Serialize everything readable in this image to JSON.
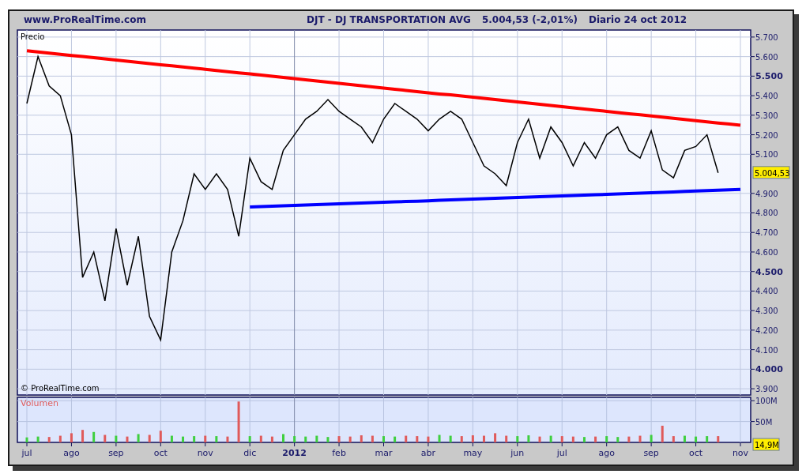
{
  "header": {
    "site": "www.ProRealTime.com",
    "title_parts": [
      "DJT - DJ TRANSPORTATION AVG",
      "5.004,53 (-2,01%)",
      "Diario  24 oct 2012"
    ]
  },
  "price_panel": {
    "label": "Precio",
    "copyright": "© ProRealTime.com",
    "last_price_tag": "5.004,53",
    "chart_data": {
      "type": "line",
      "grid": true,
      "series": [
        {
          "color": "#000000",
          "values": [
            5360,
            5600,
            5450,
            5400,
            5200,
            4470,
            4600,
            4350,
            4720,
            4430,
            4680,
            4270,
            4150,
            4600,
            4760,
            5000,
            4920,
            5000,
            4920,
            4680,
            5080,
            4960,
            4920,
            5120,
            5200,
            5280,
            5320,
            5380,
            5320,
            5280,
            5240,
            5160,
            5280,
            5360,
            5320,
            5280,
            5220,
            5280,
            5320,
            5280,
            5160,
            5040,
            5000,
            4940,
            5160,
            5280,
            5080,
            5240,
            5160,
            5040,
            5160,
            5080,
            5200,
            5240,
            5120,
            5080,
            5220,
            5020,
            4980,
            5120,
            5140,
            5200,
            5005,
            null,
            null
          ]
        },
        {
          "color": "#ff0000",
          "values": [
            5630,
            5624,
            5618,
            5612,
            5606,
            5600,
            5594,
            5588,
            5582,
            5576,
            5570,
            5564,
            5558,
            5553,
            5547,
            5541,
            5535,
            5529,
            5523,
            5517,
            5511,
            5505,
            5499,
            5493,
            5487,
            5481,
            5475,
            5469,
            5463,
            5457,
            5451,
            5445,
            5439,
            5433,
            5427,
            5421,
            5415,
            5409,
            5404,
            5398,
            5392,
            5386,
            5380,
            5374,
            5368,
            5362,
            5356,
            5350,
            5344,
            5338,
            5332,
            5326,
            5320,
            5314,
            5308,
            5302,
            5296,
            5290,
            5284,
            5278,
            5272,
            5266,
            5260,
            5255,
            5249
          ]
        },
        {
          "color": "#0000ff",
          "values": [
            null,
            null,
            null,
            null,
            null,
            null,
            null,
            null,
            null,
            null,
            null,
            null,
            null,
            null,
            null,
            null,
            null,
            null,
            null,
            null,
            4830,
            4832,
            4834,
            4836,
            4838,
            4840,
            4842,
            4844,
            4846,
            4848,
            4850,
            4852,
            4854,
            4856,
            4858,
            4860,
            4862,
            4865,
            4867,
            4869,
            4871,
            4873,
            4875,
            4877,
            4879,
            4881,
            4883,
            4885,
            4887,
            4889,
            4891,
            4893,
            4895,
            4897,
            4899,
            4901,
            4903,
            4905,
            4907,
            4910,
            4912,
            4914,
            4916,
            4918,
            4920
          ]
        }
      ],
      "ylim": [
        3868,
        5736
      ],
      "yticks": [
        {
          "value": 3900,
          "label": "3.900"
        },
        {
          "value": 4000,
          "label": "4.000"
        },
        {
          "value": 4100,
          "label": "4.100"
        },
        {
          "value": 4200,
          "label": "4.200"
        },
        {
          "value": 4300,
          "label": "4.300"
        },
        {
          "value": 4400,
          "label": "4.400"
        },
        {
          "value": 4500,
          "label": "4.500"
        },
        {
          "value": 4600,
          "label": "4.600"
        },
        {
          "value": 4700,
          "label": "4.700"
        },
        {
          "value": 4800,
          "label": "4.800"
        },
        {
          "value": 4900,
          "label": "4.900"
        },
        {
          "value": 5100,
          "label": "5.100"
        },
        {
          "value": 5200,
          "label": "5.200"
        },
        {
          "value": 5300,
          "label": "5.300"
        },
        {
          "value": 5400,
          "label": "5.400"
        },
        {
          "value": 5500,
          "label": "5.500"
        },
        {
          "value": 5600,
          "label": "5.600"
        },
        {
          "value": 5700,
          "label": "5.700"
        }
      ]
    }
  },
  "volume_panel": {
    "label": "Volumen",
    "last_volume_tag": "14,9M",
    "chart_data": {
      "type": "bar",
      "grid": true,
      "categories": [
        "jul",
        null,
        null,
        null,
        "ago",
        null,
        null,
        null,
        "sep",
        null,
        null,
        null,
        "oct",
        null,
        null,
        null,
        "nov",
        null,
        null,
        null,
        "dic",
        null,
        null,
        null,
        "2012",
        null,
        null,
        null,
        "feb",
        null,
        null,
        null,
        "mar",
        null,
        null,
        null,
        "abr",
        null,
        null,
        null,
        "may",
        null,
        null,
        null,
        "jun",
        null,
        null,
        null,
        "jul",
        null,
        null,
        null,
        "ago",
        null,
        null,
        null,
        "sep",
        null,
        null,
        null,
        "oct",
        null,
        null,
        null,
        "nov"
      ],
      "series": [
        {
          "values": [
            12,
            14,
            13,
            16,
            22,
            30,
            25,
            18,
            16,
            14,
            20,
            18,
            28,
            16,
            14,
            15,
            16,
            15,
            14,
            98,
            15,
            16,
            14,
            20,
            15,
            14,
            16,
            13,
            15,
            14,
            17,
            16,
            15,
            14,
            16,
            15,
            14,
            18,
            16,
            15,
            17,
            16,
            22,
            16,
            15,
            17,
            14,
            16,
            15,
            14,
            13,
            14,
            15,
            13,
            14,
            16,
            18,
            40,
            15,
            16,
            14,
            15,
            15,
            null,
            null
          ]
        }
      ],
      "ylim": [
        0,
        108
      ],
      "yticks": [
        {
          "value": 50,
          "label": "50M"
        },
        {
          "value": 100,
          "label": "100M"
        }
      ]
    }
  }
}
